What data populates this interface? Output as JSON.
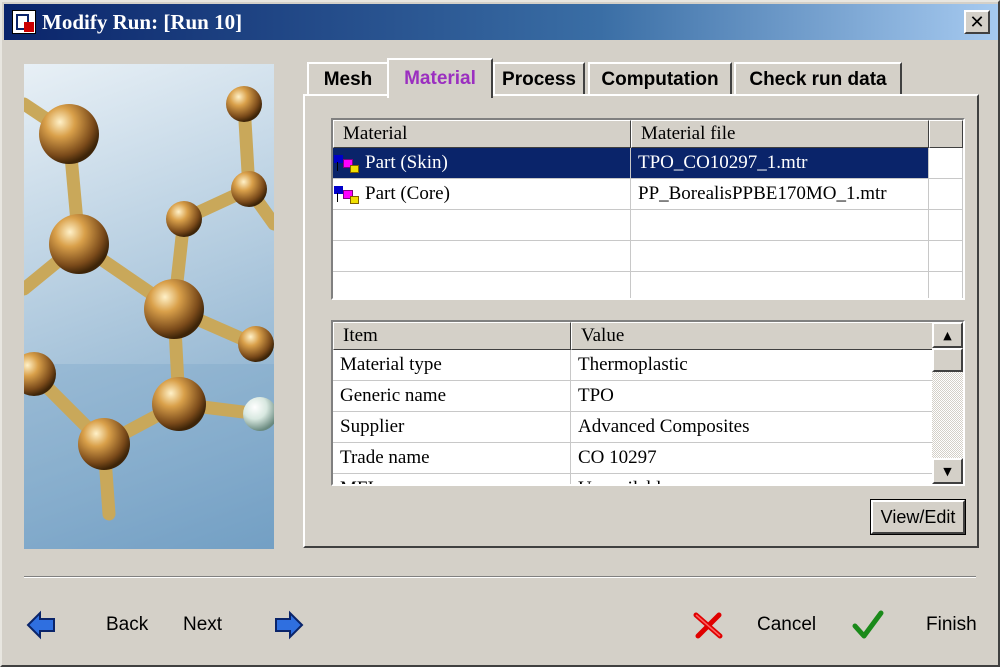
{
  "window": {
    "title": "Modify Run: [Run 10]"
  },
  "tabs": [
    {
      "label": "Mesh"
    },
    {
      "label": "Material",
      "active": true
    },
    {
      "label": "Process"
    },
    {
      "label": "Computation"
    },
    {
      "label": "Check run data"
    }
  ],
  "material_table": {
    "columns": [
      "Material",
      "Material file"
    ],
    "rows": [
      {
        "material": "Part (Skin)",
        "file": "TPO_CO10297_1.mtr",
        "selected": true
      },
      {
        "material": "Part (Core)",
        "file": "PP_BorealisPPBE170MO_1.mtr"
      }
    ]
  },
  "properties_table": {
    "columns": [
      "Item",
      "Value"
    ],
    "rows": [
      {
        "item": "Material type",
        "value": "Thermoplastic"
      },
      {
        "item": "Generic name",
        "value": "TPO"
      },
      {
        "item": "Supplier",
        "value": "Advanced Composites"
      },
      {
        "item": "Trade name",
        "value": "CO 10297"
      },
      {
        "item": "MFI",
        "value": "Unavailable"
      }
    ]
  },
  "buttons": {
    "view_edit": "View/Edit",
    "back": "Back",
    "next": "Next",
    "cancel": "Cancel",
    "finish": "Finish"
  },
  "colors": {
    "active_tab": "#9b2fc0",
    "selection": "#0a246a",
    "title_start": "#0a246a",
    "title_end": "#a6caf0"
  }
}
